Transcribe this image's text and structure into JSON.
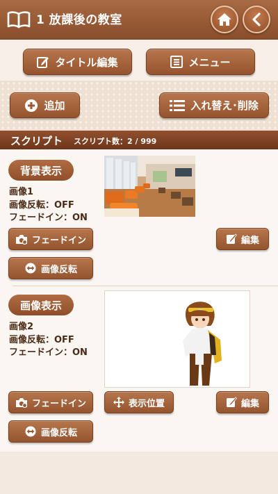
{
  "header": {
    "title": "1 放課後の教室"
  },
  "toolbar": {
    "title_edit_label": "タイトル編集",
    "menu_label": "メニュー"
  },
  "actions": {
    "add_label": "追加",
    "sort_delete_label": "入れ替え･削除"
  },
  "section": {
    "title": "スクリプト",
    "count_label": "スクリプト数：2 / 999"
  },
  "scripts": [
    {
      "type_label": "背景表示",
      "info": [
        "画像1",
        "画像反転：OFF",
        "フェードイン：ON"
      ],
      "fade_label": "フェードイン",
      "edit_label": "編集",
      "flip_label": "画像反転"
    },
    {
      "type_label": "画像表示",
      "info": [
        "画像2",
        "画像反転：OFF",
        "フェードイン：ON"
      ],
      "fade_label": "フェードイン",
      "position_label": "表示位置",
      "edit_label": "編集",
      "flip_label": "画像反転"
    }
  ],
  "colors": {
    "accent": "#9a5a33",
    "header": "#8f4f2a",
    "background": "#f6ece4"
  }
}
